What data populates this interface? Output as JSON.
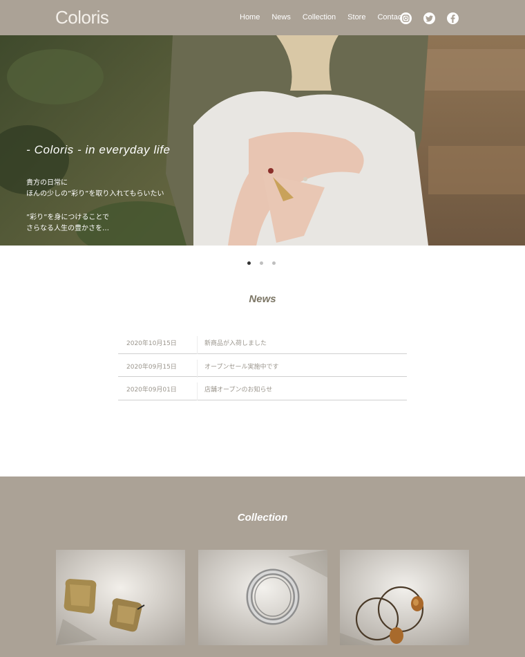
{
  "header": {
    "logo": "Coloris",
    "nav": [
      "Home",
      "News",
      "Collection",
      "Store",
      "Contact"
    ],
    "social": [
      "instagram-icon",
      "twitter-icon",
      "facebook-icon"
    ]
  },
  "hero": {
    "title": "- Coloris - in everyday life",
    "lines": [
      "貴方の日常に",
      "ほんの少しの”彩り”を取り入れてもらいたい",
      "”彩り”を身につけることで",
      "さらなる人生の豊かさを…"
    ]
  },
  "slider": {
    "active_index": 0,
    "count": 3
  },
  "news": {
    "heading": "News",
    "items": [
      {
        "date": "2020年10月15日",
        "title": "新商品が入荷しました"
      },
      {
        "date": "2020年09月15日",
        "title": "オープンセール実施中です"
      },
      {
        "date": "2020年09月01日",
        "title": "店舗オープンのお知らせ"
      }
    ]
  },
  "collection": {
    "heading": "Collection",
    "items": [
      "gold-square-earrings",
      "silver-ring",
      "hoop-earrings"
    ]
  },
  "colors": {
    "header_bg": "#aba296",
    "collection_bg": "#aba296",
    "heading_text": "#7c7665"
  }
}
